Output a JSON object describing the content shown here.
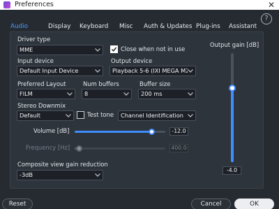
{
  "window": {
    "title": "Preferences"
  },
  "tabs": [
    {
      "label": "Audio",
      "active": true
    },
    {
      "label": "Display"
    },
    {
      "label": "Keyboard"
    },
    {
      "label": "Misc"
    },
    {
      "label": "Auth & Updates"
    },
    {
      "label": "Plug-ins"
    },
    {
      "label": "Assistant"
    }
  ],
  "audio": {
    "driver_type": {
      "label": "Driver type",
      "value": "MME"
    },
    "close_when_not_in_use": {
      "label": "Close when not in use",
      "checked": true
    },
    "input_device": {
      "label": "Input device",
      "value": "Default Input Device"
    },
    "output_device": {
      "label": "Output device",
      "value": "Playback 5-6 (IXI MEGA M2 I"
    },
    "preferred_layout": {
      "label": "Preferred Layout",
      "value": "FILM"
    },
    "num_buffers": {
      "label": "Num buffers",
      "value": "8"
    },
    "buffer_size": {
      "label": "Buffer size",
      "value": "200 ms"
    },
    "stereo_downmix": {
      "label": "Stereo Downmix",
      "value": "Default"
    },
    "test_tone": {
      "label": "Test tone",
      "checked": false,
      "value": "Channel Identification"
    },
    "volume": {
      "label": "Volume [dB]",
      "value": "-12.0",
      "level": 0.85
    },
    "frequency": {
      "label": "Frequency [Hz]",
      "value": "400.0",
      "level": 0.05,
      "enabled": false
    },
    "composite_gain_reduction": {
      "label": "Composite view gain reduction",
      "value": "-3dB"
    },
    "output_gain": {
      "label": "Output gain [dB]",
      "value": "-4.0",
      "level": 0.68
    }
  },
  "footer": {
    "reset_label": "Reset",
    "cancel_label": "Cancel",
    "ok_label": "OK"
  },
  "colors": {
    "accent": "#3f8cff",
    "active_tab": "#4b9cff",
    "background": "#262b32"
  },
  "icons": {
    "app": "app-icon",
    "close": "close-icon",
    "help": "help-icon",
    "dropdown": "chevron-down-icon",
    "check": "check-icon"
  }
}
